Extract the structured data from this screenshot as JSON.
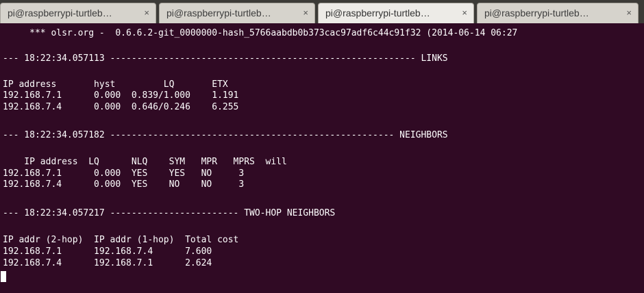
{
  "tabs": [
    {
      "label": "pi@raspberrypi-turtleb…",
      "close": "×",
      "active": false
    },
    {
      "label": "pi@raspberrypi-turtleb…",
      "close": "×",
      "active": false
    },
    {
      "label": "pi@raspberrypi-turtleb…",
      "close": "×",
      "active": true
    },
    {
      "label": "pi@raspberrypi-turtleb…",
      "close": "×",
      "active": false
    }
  ],
  "terminal": {
    "banner": "     *** olsr.org -  0.6.6.2-git_0000000-hash_5766aabdb0b373cac97adf6c44c91f32 (2014-06-14 06:27",
    "links": {
      "header": "--- 18:22:34.057113 --------------------------------------------------------- LINKS",
      "columns": "IP address       hyst         LQ       ETX",
      "rows": [
        "192.168.7.1      0.000  0.839/1.000    1.191",
        "192.168.7.4      0.000  0.646/0.246    6.255"
      ]
    },
    "neighbors": {
      "header": "--- 18:22:34.057182 ----------------------------------------------------- NEIGHBORS",
      "columns": "    IP address  LQ      NLQ    SYM   MPR   MPRS  will",
      "rows": [
        "192.168.7.1      0.000  YES    YES   NO     3",
        "192.168.7.4      0.000  YES    NO    NO     3"
      ]
    },
    "two_hop": {
      "header": "--- 18:22:34.057217 ------------------------ TWO-HOP NEIGHBORS",
      "columns": "IP addr (2-hop)  IP addr (1-hop)  Total cost",
      "rows": [
        "192.168.7.1      192.168.7.4      7.600",
        "192.168.7.4      192.168.7.1      2.624"
      ]
    }
  }
}
